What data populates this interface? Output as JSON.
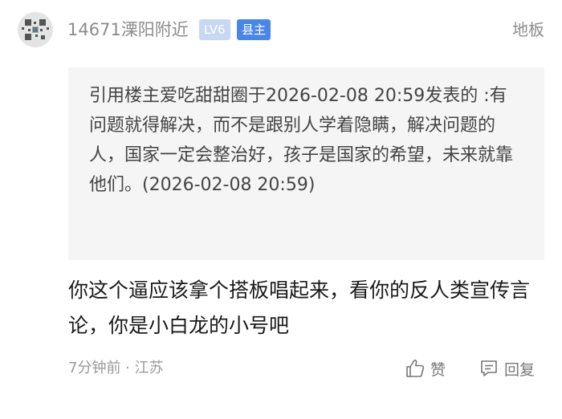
{
  "post": {
    "author": "14671溧阳附近",
    "level_badge": "LV6",
    "role_badge": "县主",
    "floor": "地板",
    "quote": "引用楼主爱吃甜甜圈于2026-02-08 20:59发表的 :有问题就得解决，而不是跟别人学着隐瞒，解决问题的人，国家一定会整治好，孩子是国家的希望，未来就靠他们。(2026-02-08 20:59)",
    "body": "你这个逼应该拿个搭板唱起来，看你的反人类宣传言论，你是小白龙的小号吧",
    "meta": "7分钟前 · 江苏",
    "like_label": "赞",
    "reply_label": "回复"
  },
  "colors": {
    "role_badge": "#4a86e8",
    "level_badge": "#c8d8f3",
    "quote_bg": "#f5f5f5"
  },
  "icons": {
    "avatar": "qr-code-avatar",
    "like": "thumbs-up-icon",
    "reply": "comment-icon"
  }
}
